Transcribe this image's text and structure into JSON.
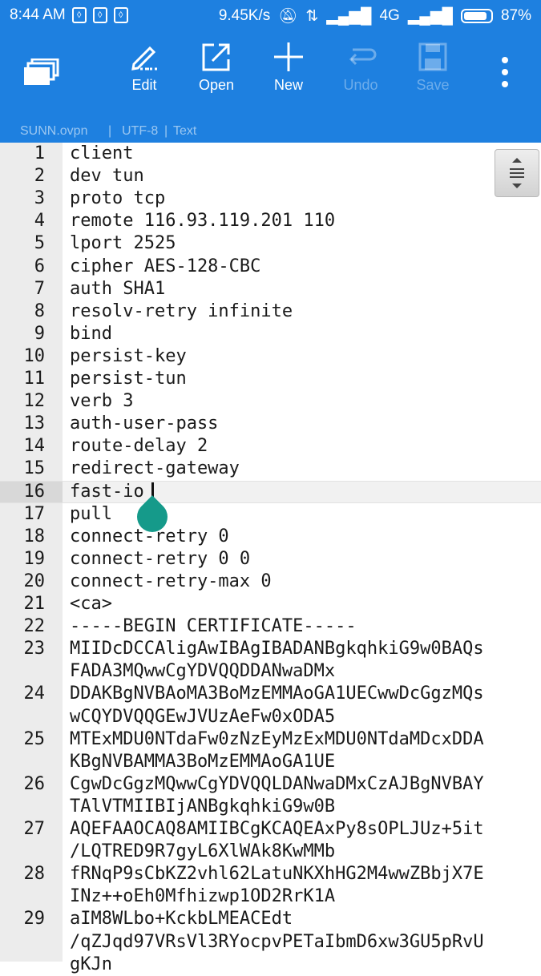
{
  "status_bar": {
    "time": "8:44 AM",
    "net_speed": "9.45K/s",
    "network": "4G",
    "battery": "87%"
  },
  "toolbar": {
    "edit_label": "Edit",
    "open_label": "Open",
    "new_label": "New",
    "undo_label": "Undo",
    "save_label": "Save"
  },
  "file_info": {
    "filename": "SUNN.ovpn",
    "encoding": "UTF-8",
    "mode": "Text"
  },
  "editor": {
    "current_line": "16",
    "lines": [
      {
        "num": "1",
        "text": "client"
      },
      {
        "num": "2",
        "text": "dev tun"
      },
      {
        "num": "3",
        "text": "proto tcp"
      },
      {
        "num": "4",
        "text": "remote 116.93.119.201 110"
      },
      {
        "num": "5",
        "text": "lport 2525"
      },
      {
        "num": "6",
        "text": "cipher AES-128-CBC"
      },
      {
        "num": "7",
        "text": "auth SHA1"
      },
      {
        "num": "8",
        "text": "resolv-retry infinite"
      },
      {
        "num": "9",
        "text": "bind"
      },
      {
        "num": "10",
        "text": "persist-key"
      },
      {
        "num": "11",
        "text": "persist-tun"
      },
      {
        "num": "12",
        "text": "verb 3"
      },
      {
        "num": "13",
        "text": "auth-user-pass"
      },
      {
        "num": "14",
        "text": "route-delay 2"
      },
      {
        "num": "15",
        "text": "redirect-gateway"
      },
      {
        "num": "16",
        "text": "fast-io"
      },
      {
        "num": "17",
        "text": "pull"
      },
      {
        "num": "18",
        "text": "connect-retry 0"
      },
      {
        "num": "19",
        "text": "connect-retry 0 0"
      },
      {
        "num": "20",
        "text": "connect-retry-max 0"
      },
      {
        "num": "21",
        "text": "<ca>"
      },
      {
        "num": "22",
        "text": "-----BEGIN CERTIFICATE-----"
      },
      {
        "num": "23",
        "text": "MIIDcDCCAligAwIBAgIBADANBgkqhkiG9w0BAQs"
      },
      {
        "num": "",
        "text": "FADA3MQwwCgYDVQQDDANwaDMx"
      },
      {
        "num": "24",
        "text": "DDAKBgNVBAoMA3BoMzEMMAoGA1UECwwDcGgzMQs"
      },
      {
        "num": "",
        "text": "wCQYDVQQGEwJVUzAeFw0xODA5"
      },
      {
        "num": "25",
        "text": "MTExMDU0NTdaFw0zNzEyMzExMDU0NTdaMDcxDDA"
      },
      {
        "num": "",
        "text": "KBgNVBAMMA3BoMzEMMAoGA1UE"
      },
      {
        "num": "26",
        "text": "CgwDcGgzMQwwCgYDVQQLDANwaDMxCzAJBgNVBAY"
      },
      {
        "num": "",
        "text": "TAlVTMIIBIjANBgkqhkiG9w0B"
      },
      {
        "num": "27",
        "text": "AQEFAAOCAQ8AMIIBCgKCAQEAxPy8sOPLJUz+5it"
      },
      {
        "num": "",
        "text": "/LQTRED9R7gyL6XlWAk8KwMMb"
      },
      {
        "num": "28",
        "text": "fRNqP9sCbKZ2vhl62LatuNKXhHG2M4wwZBbjX7E"
      },
      {
        "num": "",
        "text": "INz++oEh0Mfhizwp1OD2RrK1A"
      },
      {
        "num": "29",
        "text": "aIM8WLbo+KckbLMEACEdt"
      },
      {
        "num": "",
        "text": "/qZJqd97VRsVl3RYocpvPETaIbmD6xw3GU5pRvU"
      },
      {
        "num": "",
        "text": "gKJn"
      }
    ]
  }
}
